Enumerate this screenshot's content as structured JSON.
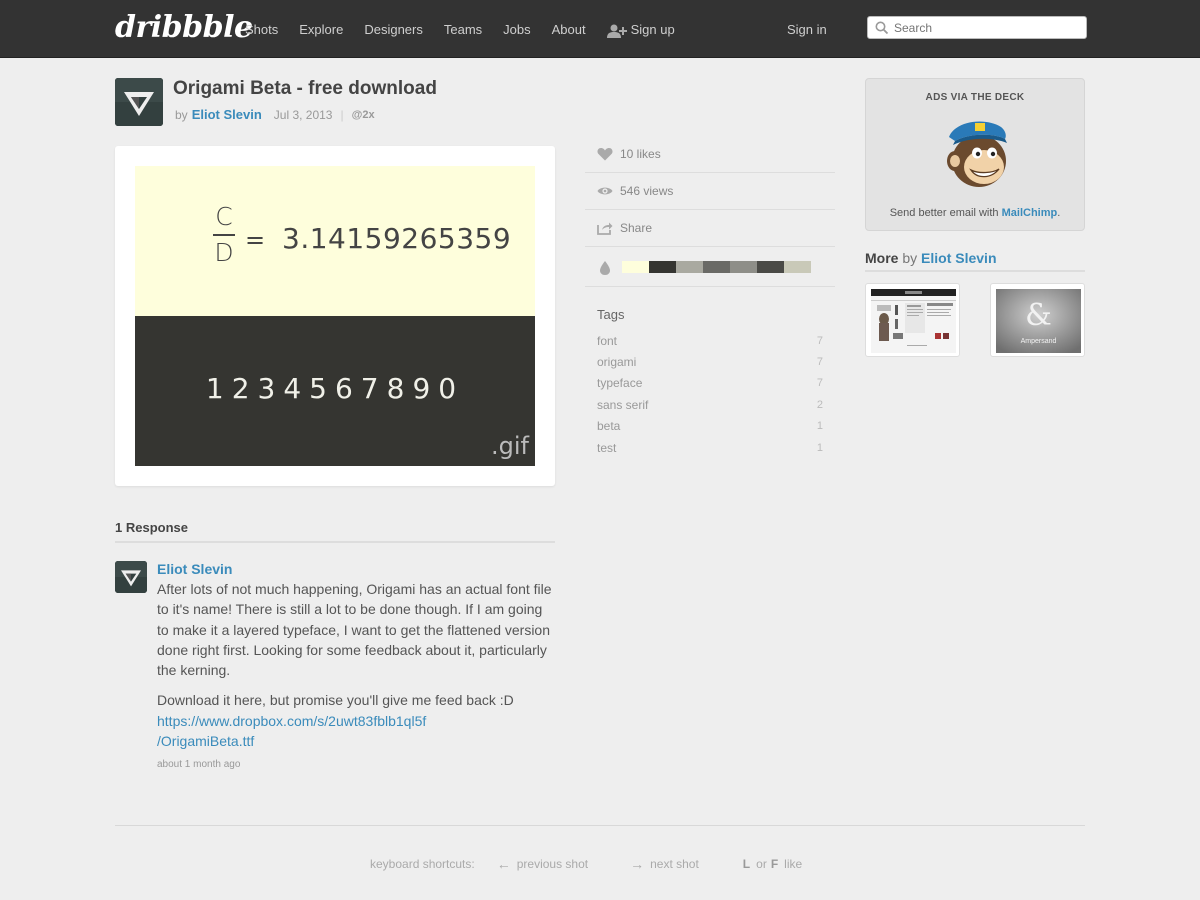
{
  "header": {
    "logo": "dribbble",
    "nav": [
      "Shots",
      "Explore",
      "Designers",
      "Teams",
      "Jobs",
      "About"
    ],
    "signup_label": "Sign up",
    "signin_label": "Sign in",
    "search_placeholder": "Search"
  },
  "shot": {
    "title": "Origami Beta - free download",
    "by_prefix": "by",
    "author": "Eliot Slevin",
    "date": "Jul 3, 2013",
    "resolution": "@2x",
    "image": {
      "numerator": "C",
      "denominator": "D",
      "equals": "=",
      "pi": "3.14159265359",
      "digits": "1234567890",
      "extension": ".gif",
      "top_color": "#fefedc",
      "bottom_color": "#353531"
    }
  },
  "meta": {
    "likes": "10 likes",
    "views": "546 views",
    "share": "Share",
    "palette": [
      "#fefedc",
      "#353531",
      "#a9a9a0",
      "#6a6a66",
      "#8e8e88",
      "#4a4a46",
      "#c9c9b8"
    ]
  },
  "tags": {
    "title": "Tags",
    "items": [
      {
        "name": "font",
        "count": "7"
      },
      {
        "name": "origami",
        "count": "7"
      },
      {
        "name": "typeface",
        "count": "7"
      },
      {
        "name": "sans serif",
        "count": "2"
      },
      {
        "name": "beta",
        "count": "1"
      },
      {
        "name": "test",
        "count": "1"
      }
    ]
  },
  "ad": {
    "label": "ADS VIA THE DECK",
    "text_prefix": "Send better email with",
    "brand": "MailChimp",
    "text_suffix": "."
  },
  "more": {
    "label": "More",
    "by": "by",
    "author": "Eliot Slevin",
    "thumb2_text": "Ampersand",
    "thumb2_glyph": "&"
  },
  "responses": {
    "title": "1 Response",
    "comment": {
      "author": "Eliot Slevin",
      "paragraph1": "After lots of not much happening, Origami has an actual font file to it's name! There is still a lot to be done though. If I am going to make it a layered typeface, I want to get the flattened version done right first. Looking for some feedback about it, particularly the kerning.",
      "paragraph2": "Download it here, but promise you'll give me feed back :D",
      "link_line1": "https://www.dropbox.com/s/2uwt83fblb1ql5f",
      "link_line2": "/OrigamiBeta.ttf",
      "time": "about 1 month ago"
    }
  },
  "footer": {
    "shortcuts_label": "keyboard shortcuts:",
    "prev_arrow": "←",
    "prev_label": "previous shot",
    "next_arrow": "→",
    "next_label": "next shot",
    "key_l": "L",
    "or": "or",
    "key_f": "F",
    "like": "like"
  }
}
